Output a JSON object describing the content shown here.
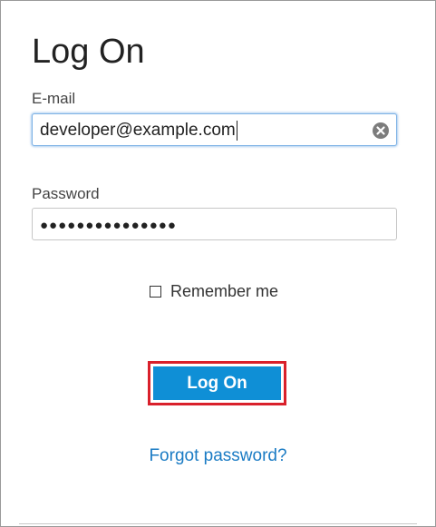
{
  "form": {
    "title": "Log On",
    "email": {
      "label": "E-mail",
      "value": "developer@example.com"
    },
    "password": {
      "label": "Password",
      "masked_value": "●●●●●●●●●●●●●●●"
    },
    "remember_me": {
      "label": "Remember me",
      "checked": false
    },
    "submit_label": "Log On",
    "forgot_link": "Forgot password?"
  },
  "icons": {
    "clear": "clear-icon"
  },
  "colors": {
    "primary_button": "#0f8fd6",
    "highlight_outline": "#d9202b",
    "link": "#1a7bc4",
    "focus_border": "#7fb3e6"
  }
}
